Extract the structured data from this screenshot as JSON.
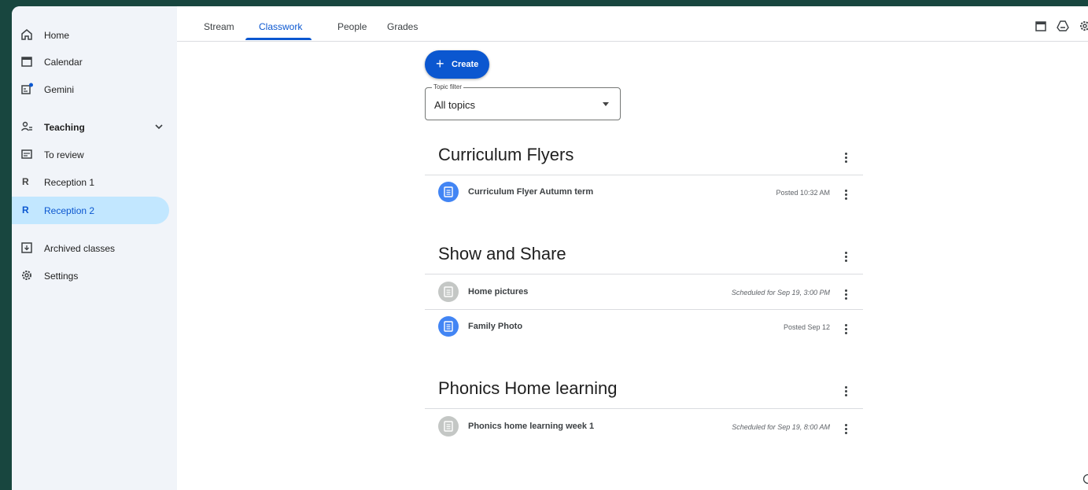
{
  "sidebar": {
    "items": [
      {
        "label": "Home",
        "icon": "home-icon"
      },
      {
        "label": "Calendar",
        "icon": "calendar-icon"
      },
      {
        "label": "Gemini",
        "icon": "gemini-icon"
      },
      {
        "label": "Teaching",
        "icon": "teaching-icon"
      },
      {
        "label": "To review",
        "icon": "review-icon"
      },
      {
        "label": "Reception 1",
        "letter": "R"
      },
      {
        "label": "Reception 2",
        "letter": "R",
        "active": true
      },
      {
        "label": "Archived classes",
        "icon": "archive-icon"
      },
      {
        "label": "Settings",
        "icon": "gear-icon"
      }
    ]
  },
  "tabs": [
    {
      "label": "Stream"
    },
    {
      "label": "Classwork",
      "active": true
    },
    {
      "label": "People"
    },
    {
      "label": "Grades"
    }
  ],
  "main": {
    "create_label": "Create",
    "filter": {
      "label": "Topic filter",
      "value": "All topics"
    },
    "topics": [
      {
        "title": "Curriculum Flyers",
        "items": [
          {
            "title": "Curriculum Flyer Autumn term",
            "meta": "Posted 10:32 AM",
            "status": "posted"
          }
        ]
      },
      {
        "title": "Show and Share",
        "items": [
          {
            "title": "Home pictures",
            "meta": "Scheduled for Sep 19, 3:00 PM",
            "status": "scheduled"
          },
          {
            "title": "Family Photo",
            "meta": "Posted Sep 12",
            "status": "posted"
          }
        ]
      },
      {
        "title": "Phonics Home learning",
        "items": [
          {
            "title": "Phonics home learning week 1",
            "meta": "Scheduled for Sep 19, 8:00 AM",
            "status": "scheduled"
          }
        ]
      }
    ]
  },
  "colors": {
    "accent": "#0b57d0",
    "active_nav_bg": "#c2e7ff",
    "posted_icon": "#4285f4",
    "scheduled_icon": "#c4c7c5",
    "outer_bg": "#18463f"
  }
}
